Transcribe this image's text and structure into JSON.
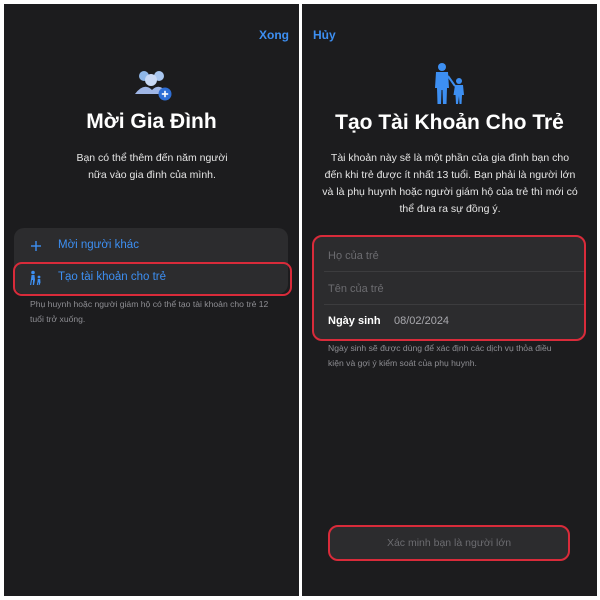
{
  "left": {
    "done_label": "Xong",
    "title": "Mời Gia Đình",
    "description": "Bạn có thể thêm đến năm người nữa vào gia đình của mình.",
    "options": [
      {
        "label": "Mời người khác",
        "icon": "plus-icon"
      },
      {
        "label": "Tạo tài khoản cho trẻ",
        "icon": "child-walking-icon"
      }
    ],
    "note": "Phụ huynh hoặc người giám hộ có thể tạo tài khoản cho trẻ 12 tuổi trở xuống."
  },
  "right": {
    "cancel_label": "Hủy",
    "title": "Tạo Tài Khoản Cho Trẻ",
    "description": "Tài khoản này sẽ là một phần của gia đình bạn cho đến khi trẻ được ít nhất 13 tuổi. Bạn phải là người lớn và là phụ huynh hoặc người giám hộ của trẻ thì mới có thể đưa ra sự đồng ý.",
    "form": {
      "first_name_placeholder": "Họ của trẻ",
      "last_name_placeholder": "Tên của trẻ",
      "dob_label": "Ngày sinh",
      "dob_value": "08/02/2024"
    },
    "note": "Ngày sinh sẽ được dùng để xác định các dịch vụ thỏa điều kiện và gợi ý kiểm soát của phụ huynh.",
    "verify_button": "Xác minh bạn là người lớn"
  },
  "colors": {
    "background": "#1c1c1e",
    "card": "#2c2c2e",
    "accent": "#3d8ff2",
    "highlight": "#d92b3a"
  }
}
